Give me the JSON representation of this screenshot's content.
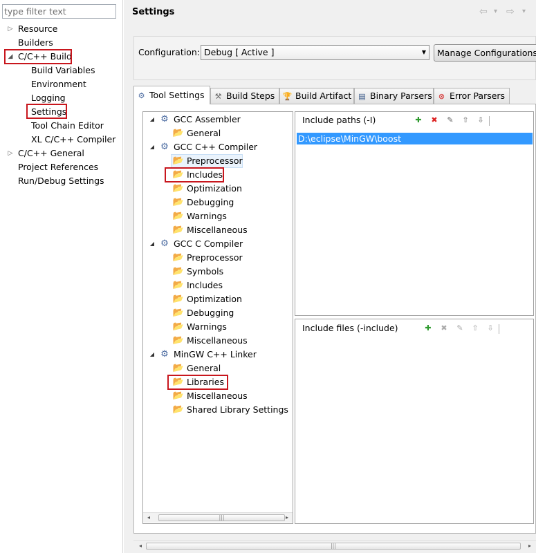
{
  "left_pane": {
    "filter_placeholder": "type filter text",
    "items": [
      {
        "label": "Resource",
        "twisty": "▷"
      },
      {
        "label": "Builders",
        "twisty": ""
      },
      {
        "label": "C/C++ Build",
        "twisty": "◢"
      },
      {
        "label": "Build Variables",
        "twisty": ""
      },
      {
        "label": "Environment",
        "twisty": ""
      },
      {
        "label": "Logging",
        "twisty": ""
      },
      {
        "label": "Settings",
        "twisty": ""
      },
      {
        "label": "Tool Chain Editor",
        "twisty": ""
      },
      {
        "label": "XL C/C++ Compiler",
        "twisty": ""
      },
      {
        "label": "C/C++ General",
        "twisty": "▷"
      },
      {
        "label": "Project References",
        "twisty": ""
      },
      {
        "label": "Run/Debug Settings",
        "twisty": ""
      }
    ]
  },
  "header": {
    "title": "Settings",
    "back_icon": "⇦",
    "back_menu_icon": "▾",
    "forward_icon": "⇨",
    "forward_menu_icon": "▾"
  },
  "configuration": {
    "label": "Configuration:",
    "selected": "Debug  [ Active ]",
    "dropdown_icon": "▼",
    "manage_button": "Manage Configurations..."
  },
  "tabs": [
    {
      "label": "Tool Settings",
      "icon": "⚙"
    },
    {
      "label": "Build Steps",
      "icon": "⚒"
    },
    {
      "label": "Build Artifact",
      "icon": "🏆"
    },
    {
      "label": "Binary Parsers",
      "icon": "▤"
    },
    {
      "label": "Error Parsers",
      "icon": "⊗"
    }
  ],
  "tool_tree": [
    {
      "label": "GCC Assembler",
      "twisty": "◢"
    },
    {
      "label": "General"
    },
    {
      "label": "GCC C++ Compiler",
      "twisty": "◢"
    },
    {
      "label": "Preprocessor"
    },
    {
      "label": "Includes"
    },
    {
      "label": "Optimization"
    },
    {
      "label": "Debugging"
    },
    {
      "label": "Warnings"
    },
    {
      "label": "Miscellaneous"
    },
    {
      "label": "GCC C Compiler",
      "twisty": "◢"
    },
    {
      "label": "Preprocessor"
    },
    {
      "label": "Symbols"
    },
    {
      "label": "Includes"
    },
    {
      "label": "Optimization"
    },
    {
      "label": "Debugging"
    },
    {
      "label": "Warnings"
    },
    {
      "label": "Miscellaneous"
    },
    {
      "label": "MinGW C++ Linker",
      "twisty": "◢"
    },
    {
      "label": "General"
    },
    {
      "label": "Libraries"
    },
    {
      "label": "Miscellaneous"
    },
    {
      "label": "Shared Library Settings"
    }
  ],
  "include_paths": {
    "title": "Include paths (-I)",
    "items": [
      "D:\\eclipse\\MinGW\\boost"
    ]
  },
  "include_files": {
    "title": "Include files (-include)",
    "items": []
  },
  "toolbar_icons": {
    "add": "✚",
    "delete": "✖",
    "edit": "✎",
    "up": "⇧",
    "down": "⇩"
  },
  "scroll": {
    "left": "◂",
    "right": "▸",
    "grip": "|||"
  },
  "colors": {
    "highlight_box": "#c8161d",
    "selection": "#3399ff"
  }
}
